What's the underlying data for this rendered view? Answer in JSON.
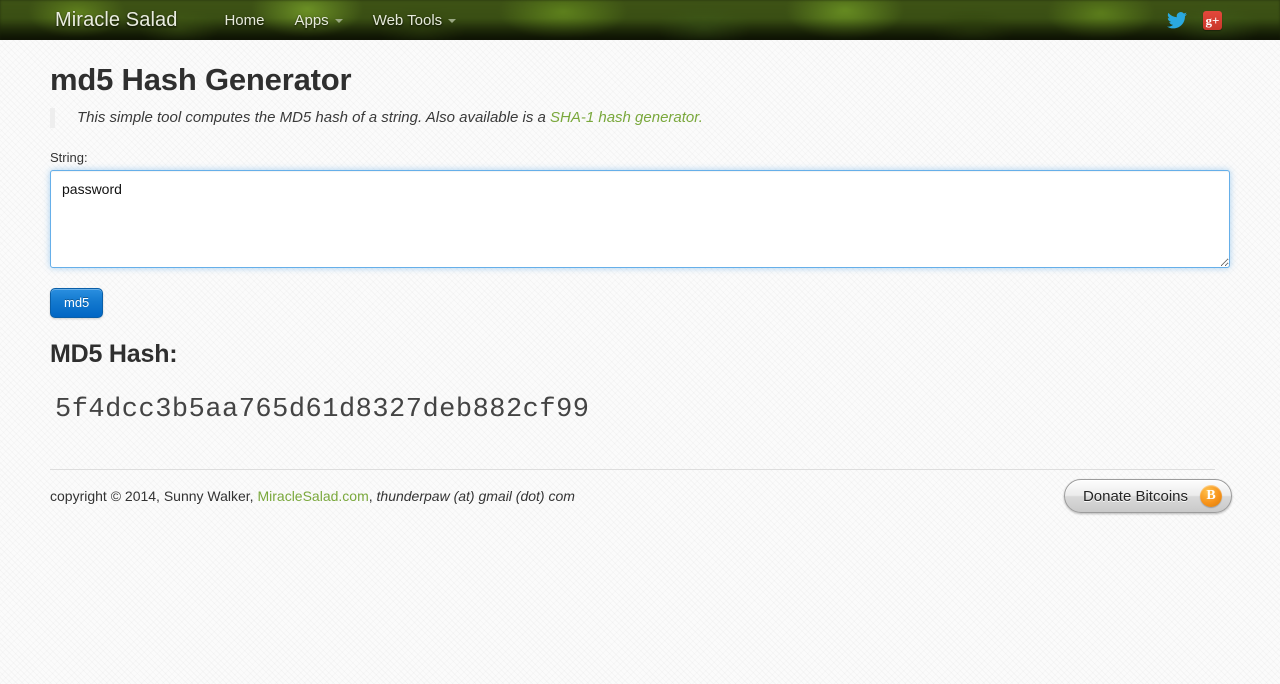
{
  "navbar": {
    "brand": "Miracle Salad",
    "links": [
      {
        "label": "Home",
        "has_caret": false
      },
      {
        "label": "Apps",
        "has_caret": true
      },
      {
        "label": "Web Tools",
        "has_caret": true
      }
    ],
    "social": [
      {
        "name": "twitter",
        "label": ""
      },
      {
        "name": "google-plus",
        "label": "g+"
      }
    ]
  },
  "main": {
    "title": "md5 Hash Generator",
    "subtitle_prefix": "This simple tool computes the MD5 hash of a string. Also available is a ",
    "subtitle_link": "SHA-1 hash generator.",
    "string_label": "String:",
    "string_value": "password",
    "string_placeholder": "",
    "submit_label": "md5",
    "hash_heading": "MD5 Hash:",
    "hash_value": "5f4dcc3b5aa765d61d8327deb882cf99"
  },
  "footer": {
    "copyright_prefix": "copyright © 2014, Sunny Walker, ",
    "site_link": "MiracleSalad.com",
    "copyright_separator": ", ",
    "email": "thunderpaw (at) gmail (dot) com",
    "donate_label": "Donate Bitcoins",
    "bitcoin_symbol": "B"
  },
  "colors": {
    "link_green": "#7aa83c",
    "button_blue": "#0166c4",
    "bitcoin_orange": "#f7931a",
    "focus_blue": "#66afe9"
  }
}
